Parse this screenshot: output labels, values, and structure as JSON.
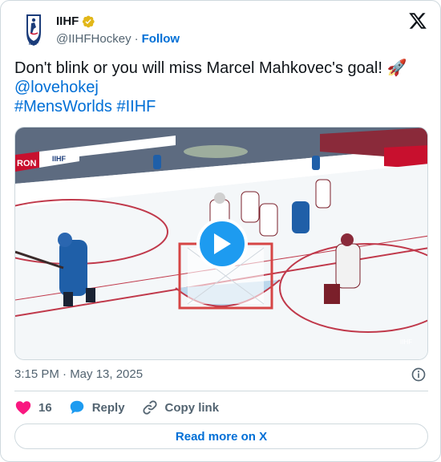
{
  "author": {
    "name": "IIHF",
    "handle": "@IIHFHockey",
    "separator": "·",
    "follow_label": "Follow",
    "avatar_text": "IIHF"
  },
  "tweet": {
    "text_main": "Don't blink or you will miss Marcel Mahkovec's goal! 🚀",
    "mention": "@lovehokej",
    "hashtags": "#MensWorlds #IIHF"
  },
  "media": {
    "type": "video",
    "watermark": "IIHF",
    "board_ads": [
      "RON",
      "IIHF"
    ]
  },
  "timestamp": "3:15 PM · May 13, 2025",
  "actions": {
    "like_count": "16",
    "reply_label": "Reply",
    "copy_label": "Copy link"
  },
  "read_more_label": "Read more on X",
  "colors": {
    "link": "#006fd6",
    "play_button": "#1d9bf0",
    "like_heart": "#f91880",
    "reply_bubble": "#1d9bf0",
    "verified_badge": "#e2b719"
  }
}
